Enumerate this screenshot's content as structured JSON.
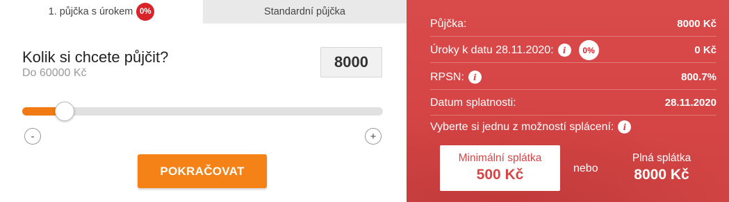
{
  "tabs": {
    "active_label": "1. půjčka s úrokem",
    "active_badge": "0%",
    "inactive_label": "Standardní půjčka"
  },
  "calculator": {
    "question": "Kolik si chcete půjčit?",
    "limit_text": "Do 60000 Kč",
    "amount_value": "8000",
    "slider_fraction": 0.117,
    "minus_label": "-",
    "plus_label": "+",
    "continue_label": "POKRAČOVAT"
  },
  "summary": {
    "loan_label": "Půjčka:",
    "loan_value": "8000 Kč",
    "interest_label": "Úroky k datu 28.11.2020:",
    "interest_badge": "0%",
    "interest_value": "0 Kč",
    "rpsn_label": "RPSN:",
    "rpsn_value": "800.7%",
    "due_label": "Datum splatnosti:",
    "due_value": "28.11.2020",
    "choose_label": "Vyberte si jednu z možností splácení:",
    "info_glyph": "i"
  },
  "repayment": {
    "min_title": "Minimální splátka",
    "min_value": "500 Kč",
    "or_label": "nebo",
    "full_title": "Plná splátka",
    "full_value": "8000 Kč"
  },
  "colors": {
    "accent_orange": "#f58216",
    "panel_red": "#d64545",
    "badge_red": "#d8232a"
  },
  "icons": [
    "info-icon",
    "percent-badge"
  ]
}
